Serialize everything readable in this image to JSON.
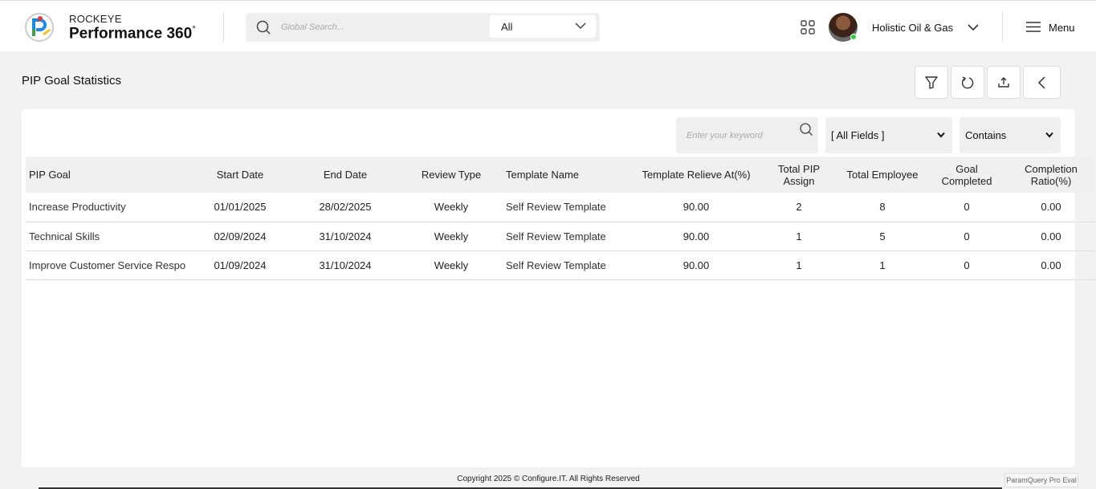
{
  "app": {
    "brand_top": "ROCKEYE",
    "brand_main": "Performance 360",
    "brand_sup": "°"
  },
  "header": {
    "search_placeholder": "Global Search...",
    "search_scope": "All",
    "company": "Holistic Oil & Gas",
    "menu_label": "Menu"
  },
  "page": {
    "title": "PIP Goal Statistics"
  },
  "filters": {
    "keyword_placeholder": "Enter your keyword",
    "field_select": "[ All Fields ]",
    "operator_select": "Contains"
  },
  "table": {
    "columns": [
      "PIP Goal",
      "Start Date",
      "End Date",
      "Review Type",
      "Template Name",
      "Template Relieve At(%)",
      "Total PIP Assign",
      "Total Employee",
      "Goal Completed",
      "Completion Ratio(%)"
    ],
    "rows": [
      [
        "Increase Productivity",
        "01/01/2025",
        "28/02/2025",
        "Weekly",
        "Self Review Template",
        "90.00",
        "2",
        "8",
        "0",
        "0.00"
      ],
      [
        "Technical Skills",
        "02/09/2024",
        "31/10/2024",
        "Weekly",
        "Self Review Template",
        "90.00",
        "1",
        "5",
        "0",
        "0.00"
      ],
      [
        "Improve Customer Service Respo",
        "01/09/2024",
        "31/10/2024",
        "Weekly",
        "Self Review Template",
        "90.00",
        "1",
        "1",
        "0",
        "0.00"
      ]
    ]
  },
  "footer": {
    "copyright": "Copyright 2025 © Configure.IT. All Rights Reserved",
    "badge": "ParamQuery Pro Eval"
  },
  "colors": {
    "background": "#f2f2f2",
    "online_status": "#2ecc40"
  }
}
